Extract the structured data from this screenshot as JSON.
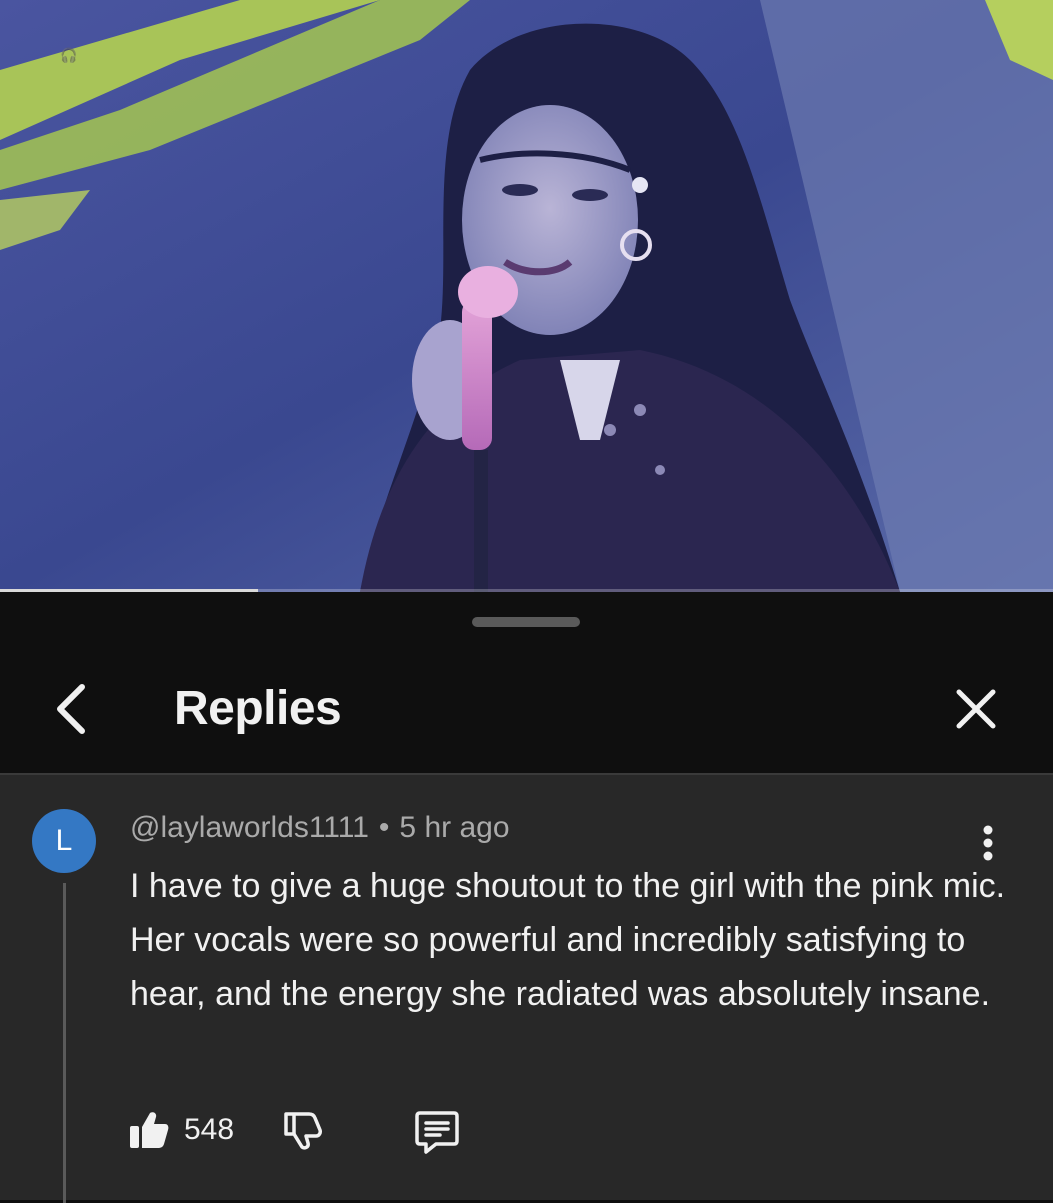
{
  "video": {
    "description_icon": "video-player",
    "progress_fraction": 0.245
  },
  "sheet": {
    "title": "Replies",
    "back_icon": "chevron-left-icon",
    "close_icon": "close-icon"
  },
  "comment": {
    "avatar_letter": "L",
    "avatar_color": "#3478c4",
    "author": "@laylaworlds1111",
    "separator": "•",
    "timestamp": "5 hr ago",
    "text": "I have to give a huge shoutout to the girl with the pink mic. Her vocals were so powerful and incredibly satisfying to hear, and the energy she radiated was absolutely insane.",
    "likes": "548",
    "like_icon": "thumbs-up-filled-icon",
    "dislike_icon": "thumbs-down-icon",
    "reply_icon": "reply-comment-icon",
    "more_icon": "more-vertical-icon"
  },
  "colors": {
    "background": "#0f0f0f",
    "comment_background": "#282828",
    "text_primary": "#f1f1f1",
    "text_secondary": "#aaaaaa"
  }
}
